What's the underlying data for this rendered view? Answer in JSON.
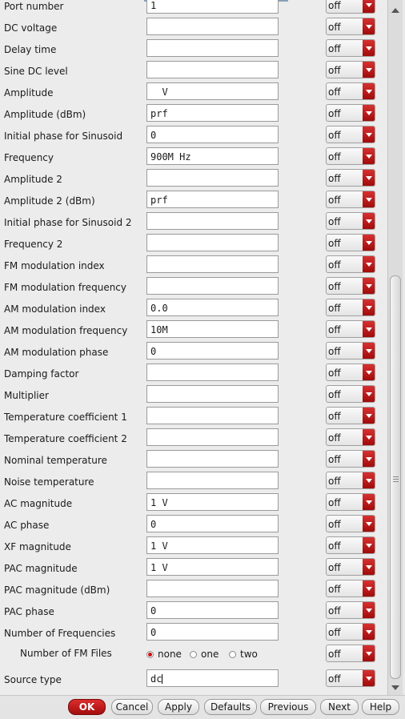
{
  "rows": [
    {
      "label": "Port number",
      "value": "1",
      "combo": "off"
    },
    {
      "label": "DC voltage",
      "value": "",
      "combo": "off"
    },
    {
      "label": "Delay time",
      "value": "",
      "combo": "off"
    },
    {
      "label": "Sine DC level",
      "value": "",
      "combo": "off"
    },
    {
      "label": "Amplitude",
      "value": "  V",
      "combo": "off"
    },
    {
      "label": "Amplitude (dBm)",
      "value": "prf",
      "combo": "off"
    },
    {
      "label": "Initial phase for Sinusoid",
      "value": "0",
      "combo": "off"
    },
    {
      "label": "Frequency",
      "value": "900M Hz",
      "combo": "off"
    },
    {
      "label": "Amplitude 2",
      "value": "",
      "combo": "off"
    },
    {
      "label": "Amplitude 2 (dBm)",
      "value": "prf",
      "combo": "off"
    },
    {
      "label": "Initial phase for Sinusoid 2",
      "value": "",
      "combo": "off"
    },
    {
      "label": "Frequency 2",
      "value": "",
      "combo": "off"
    },
    {
      "label": "FM modulation index",
      "value": "",
      "combo": "off"
    },
    {
      "label": "FM modulation frequency",
      "value": "",
      "combo": "off"
    },
    {
      "label": "AM modulation index",
      "value": "0.0",
      "combo": "off"
    },
    {
      "label": "AM modulation frequency",
      "value": "10M",
      "combo": "off"
    },
    {
      "label": "AM modulation phase",
      "value": "0",
      "combo": "off"
    },
    {
      "label": "Damping factor",
      "value": "",
      "combo": "off"
    },
    {
      "label": "Multiplier",
      "value": "",
      "combo": "off"
    },
    {
      "label": "Temperature coefficient 1",
      "value": "",
      "combo": "off"
    },
    {
      "label": "Temperature coefficient 2",
      "value": "",
      "combo": "off"
    },
    {
      "label": "Nominal temperature",
      "value": "",
      "combo": "off"
    },
    {
      "label": "Noise temperature",
      "value": "",
      "combo": "off"
    },
    {
      "label": "AC magnitude",
      "value": "1 V",
      "combo": "off"
    },
    {
      "label": "AC phase",
      "value": "0",
      "combo": "off"
    },
    {
      "label": "XF magnitude",
      "value": "1 V",
      "combo": "off"
    },
    {
      "label": "PAC magnitude",
      "value": "1 V",
      "combo": "off"
    },
    {
      "label": "PAC magnitude (dBm)",
      "value": "",
      "combo": "off"
    },
    {
      "label": "PAC phase",
      "value": "0",
      "combo": "off"
    },
    {
      "label": "Number of Frequencies",
      "value": "0",
      "combo": "off"
    }
  ],
  "fm_files": {
    "label": "Number of FM Files",
    "options": [
      "none",
      "one",
      "two"
    ],
    "selected": "none",
    "combo": "off"
  },
  "source_type": {
    "label": "Source type",
    "value": "dc",
    "combo": "off"
  },
  "buttons": {
    "ok": "OK",
    "cancel": "Cancel",
    "apply": "Apply",
    "defaults": "Defaults",
    "previous": "Previous",
    "next": "Next",
    "help": "Help"
  },
  "scrollbar": {
    "position_fraction": 0.39,
    "visible_fraction": 0.61
  }
}
